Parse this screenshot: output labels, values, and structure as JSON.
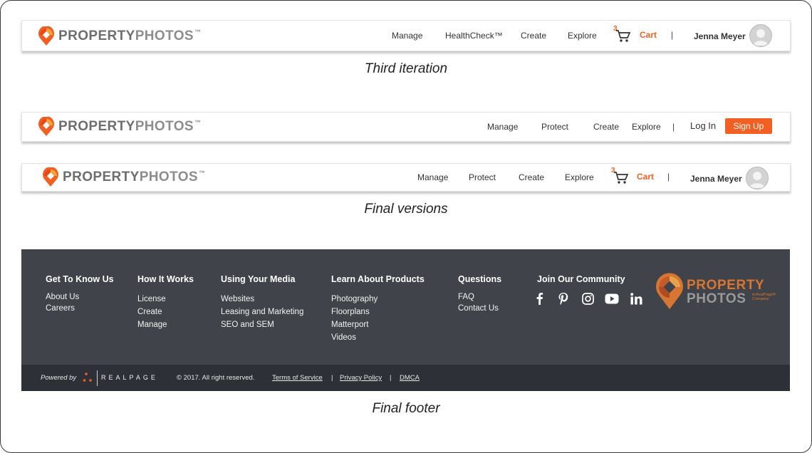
{
  "brand": {
    "name_part1": "PROPERTY",
    "name_part2": "PHOTOS",
    "trademark": "™",
    "accent": "#f25f22"
  },
  "header_third": {
    "nav": [
      "Manage",
      "HealthCheck™",
      "Create",
      "Explore"
    ],
    "cart_count": "3",
    "cart_label": "Cart",
    "separator": "|",
    "user_name": "Jenna Meyer"
  },
  "caption_third": "Third iteration",
  "header_logged_out": {
    "nav": [
      "Manage",
      "Protect",
      "Create",
      "Explore"
    ],
    "separator": "|",
    "login_label": "Log In",
    "signup_label": "Sign Up"
  },
  "header_logged_in": {
    "nav": [
      "Manage",
      "Protect",
      "Create",
      "Explore"
    ],
    "cart_count": "3",
    "cart_label": "Cart",
    "separator": "|",
    "user_name": "Jenna Meyer"
  },
  "caption_final": "Final versions",
  "footer": {
    "columns": [
      {
        "heading": "Get To Know Us",
        "links": [
          "About Us",
          "Careers"
        ]
      },
      {
        "heading": "How It Works",
        "links": [
          "License",
          "Create",
          "Manage"
        ]
      },
      {
        "heading": "Using Your Media",
        "links": [
          "Websites",
          "Leasing and Marketing",
          "SEO and SEM"
        ]
      },
      {
        "heading": "Learn About Products",
        "links": [
          "Photography",
          "Floorplans",
          "Matterport",
          "Videos"
        ]
      },
      {
        "heading": "Questions",
        "links": [
          "FAQ",
          "Contact Us"
        ]
      }
    ],
    "community_heading": "Join Our Community",
    "social_icons": [
      "facebook-icon",
      "pinterest-icon",
      "instagram-icon",
      "youtube-icon",
      "linkedin-icon"
    ],
    "logo_line1": "PROPERTY",
    "logo_line2": "PHOTOS",
    "logo_tagline": "A RealPage® Company",
    "powered_by": "Powered by",
    "realpage": "REALPAGE",
    "copyright": "© 2017. All right reserved.",
    "terms": "Terms of Service",
    "privacy": "Privacy Policy",
    "dmca": "DMCA",
    "pipe": "|"
  },
  "caption_footer": "Final footer"
}
